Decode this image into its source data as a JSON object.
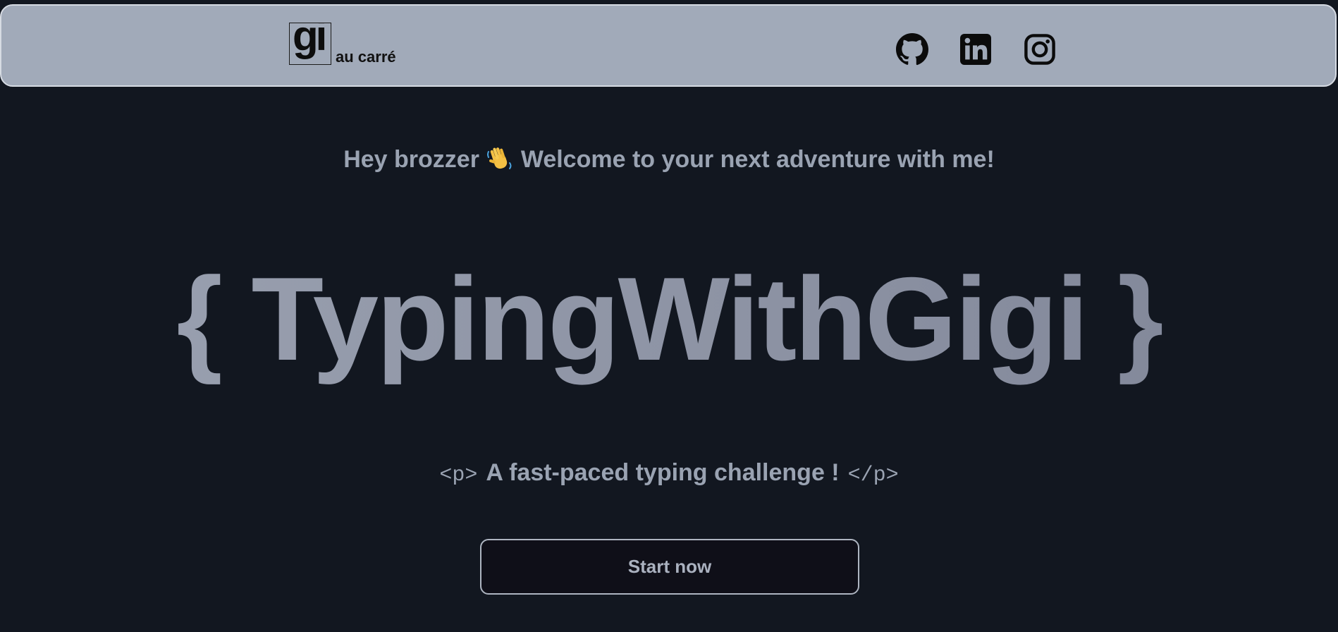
{
  "navbar": {
    "logo_mark": "gi",
    "logo_text": "au carré",
    "social_icons": [
      "github-icon",
      "linkedin-icon",
      "instagram-icon"
    ]
  },
  "hero": {
    "greeting_before": "Hey brozzer",
    "greeting_emoji": "waving-hand-icon",
    "greeting_after": "Welcome to your next adventure with me!",
    "title": "{ TypingWithGigi }",
    "subtitle_open_tag": "<p>",
    "subtitle": "A fast-paced typing challenge !",
    "subtitle_close_tag": "</p>",
    "cta_label": "Start now"
  },
  "colors": {
    "background": "#121720",
    "navbar": "#a1aab9",
    "text_muted": "#9aa3b2",
    "title": "#8f96a6",
    "button_bg": "#0f0f18"
  }
}
